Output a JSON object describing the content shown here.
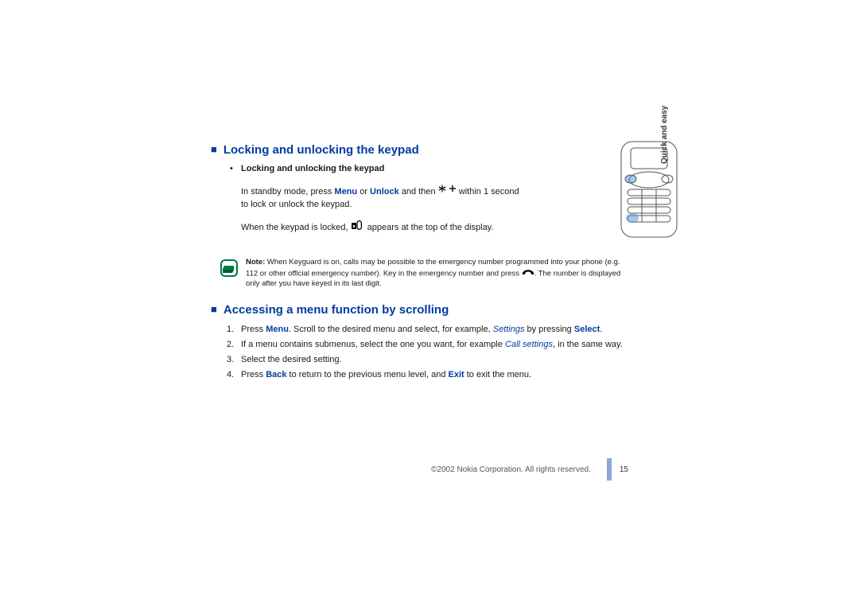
{
  "sideLabel": "Quick and easy",
  "section1": {
    "heading": "Locking and unlocking the keypad",
    "subheading": "Locking and unlocking the keypad",
    "para1_pre": "In standby mode, press ",
    "para1_menu": "Menu",
    "para1_or": " or ",
    "para1_unlock": "Unlock",
    "para1_mid": " and then ",
    "para1_post": " within 1 second to lock or unlock the keypad.",
    "para2_pre": "When the keypad is locked, ",
    "para2_post": " appears at the top of the display.",
    "note_label": "Note:",
    "note_body_a": " When Keyguard is on, calls may be possible to the emergency number programmed into your phone (e.g. 112 or other official emergency number). Key in the emergency number and press ",
    "note_body_b": ". The number is displayed only after you have keyed in its last digit."
  },
  "section2": {
    "heading": "Accessing a menu function by scrolling",
    "items": [
      {
        "num": "1.",
        "a": "Press ",
        "link1": "Menu",
        "b": ". Scroll to the desired menu and select, for example, ",
        "italic": "Settings",
        "c": " by pressing ",
        "link2": "Select",
        "d": "."
      },
      {
        "num": "2.",
        "a": "If a menu contains submenus, select the one you want, for example ",
        "italic": "Call settings",
        "b": ", in the same way."
      },
      {
        "num": "3.",
        "a": "Select the desired setting."
      },
      {
        "num": "4.",
        "a": "Press ",
        "link1": "Back",
        "b": " to return to the previous menu level, and ",
        "link2": "Exit",
        "c": " to exit the menu."
      }
    ]
  },
  "footer": {
    "copyright": "©2002 Nokia Corporation. All rights reserved.",
    "pageNumber": "15"
  }
}
